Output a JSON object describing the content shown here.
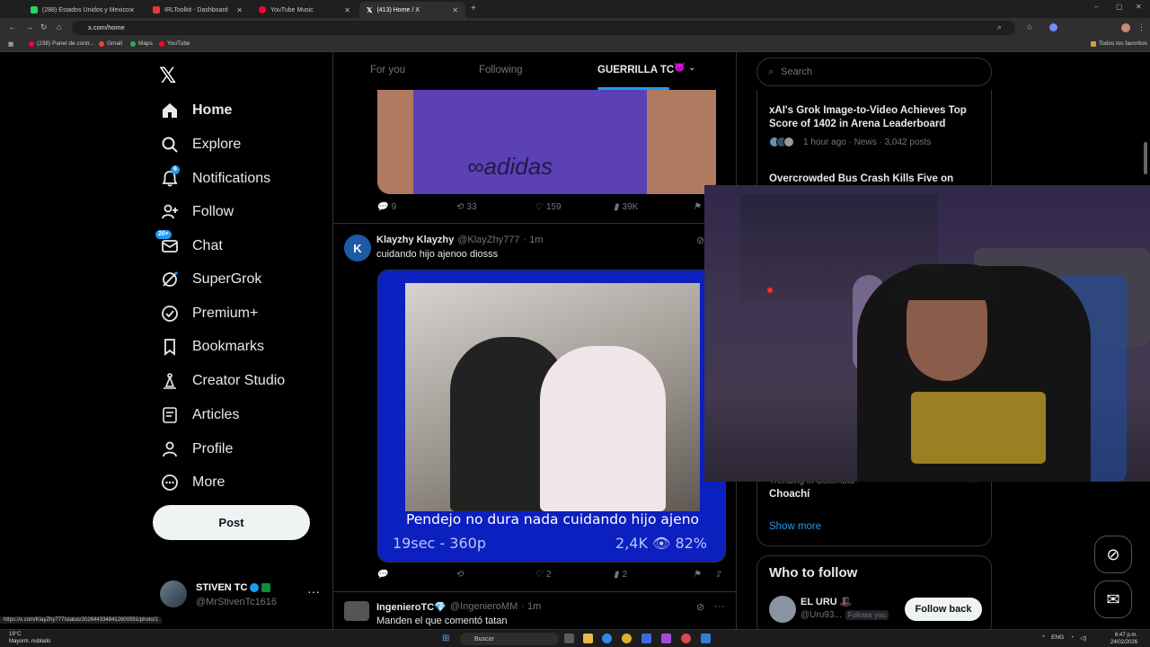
{
  "browser": {
    "tabs": [
      {
        "label": "(288) Estados Unidos y Mexico",
        "color": "#25d366"
      },
      {
        "label": "IRLToolkit - Dashboard",
        "color": "#e03a3a"
      },
      {
        "label": "YouTube Music",
        "color": "#ff0033"
      },
      {
        "label": "(413) Home / X",
        "color": "#ffffff"
      }
    ],
    "url": "x.com/home",
    "bookmarks": [
      {
        "label": "(238) Panel de contr...",
        "color": "#ff0033"
      },
      {
        "label": "Gmail",
        "color": "#ea4335"
      },
      {
        "label": "Maps",
        "color": "#34a853"
      },
      {
        "label": "YouTube",
        "color": "#ff0033"
      }
    ],
    "all_bookmarks": "Todos los favoritos",
    "status_link": "https://x.com/KlayZhy777/status/2026443348412600591/photo/1"
  },
  "sidebar": {
    "items": [
      {
        "label": "Home",
        "icon": "home-icon"
      },
      {
        "label": "Explore",
        "icon": "search-icon"
      },
      {
        "label": "Notifications",
        "icon": "bell-icon",
        "badge": "6"
      },
      {
        "label": "Follow",
        "icon": "person-plus-icon"
      },
      {
        "label": "Chat",
        "icon": "mail-icon",
        "badge": "20+"
      },
      {
        "label": "SuperGrok",
        "icon": "grok-icon"
      },
      {
        "label": "Premium+",
        "icon": "verified-icon"
      },
      {
        "label": "Bookmarks",
        "icon": "bookmark-icon"
      },
      {
        "label": "Creator Studio",
        "icon": "creator-icon"
      },
      {
        "label": "Articles",
        "icon": "articles-icon"
      },
      {
        "label": "Profile",
        "icon": "person-icon"
      },
      {
        "label": "More",
        "icon": "more-circle-icon"
      }
    ],
    "post_label": "Post",
    "account": {
      "name": "STIVEN TC",
      "handle": "@MrStivenTc1616"
    }
  },
  "timeline": {
    "tabs": [
      "For you",
      "Following",
      "GUERRILLA TC"
    ],
    "first_tweet_stats": {
      "replies": "9",
      "reposts": "33",
      "likes": "159",
      "views": "39K"
    },
    "tweet2": {
      "avatar_letter": "K",
      "name": "Klayzhy Klayzhy",
      "handle": "@KlayZhy777",
      "time": "· 1m",
      "text": "cuidando hijo ajenoo diosss",
      "media_caption": "Pendejo no dura nada cuidando hijo ajeno",
      "media_meta_left": "19sec - 360p",
      "media_meta_right": "2,4K 👁 82%",
      "stats": {
        "replies": "",
        "reposts": "",
        "likes": "2",
        "views": "2"
      }
    },
    "tweet3": {
      "name": "IngenieroTC💎",
      "handle": "@IngenieroMM",
      "time": "· 1m",
      "text": "Manden el que comentó tatan"
    }
  },
  "right": {
    "search_placeholder": "Search",
    "trends": [
      {
        "title": "xAI's Grok Image-to-Video Achieves Top Score of 1402 in Arena Leaderboard",
        "meta": "1 hour ago · News · 3,042 posts"
      },
      {
        "title": "Overcrowded Bus Crash Kills Five on",
        "meta": ""
      }
    ],
    "trend_bottom": {
      "context": "Trending in Colombia",
      "title": "Choachí"
    },
    "show_more": "Show more",
    "who_to_follow": {
      "heading": "Who to follow",
      "name": "EL URU 🎩",
      "handle": "@Uru93...",
      "follows_you": "Follows you",
      "button": "Follow back"
    }
  },
  "taskbar": {
    "weather_temp": "19°C",
    "weather_desc": "Mayorm. nublado",
    "search": "Buscar",
    "lang": "ENG",
    "time": "6:47 p.m.",
    "date": "24/02/2026"
  }
}
